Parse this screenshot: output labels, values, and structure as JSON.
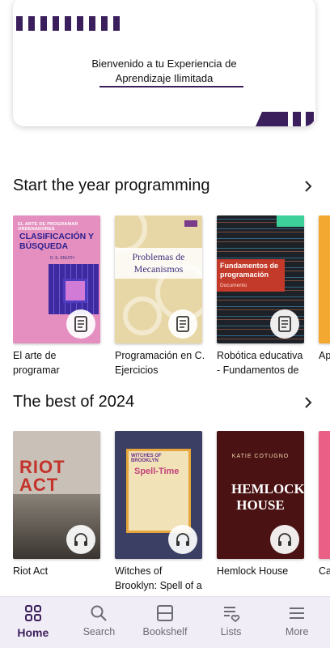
{
  "banner": {
    "line1": "Bienvenido a tu Experiencia de",
    "line2": "Aprendizaje Ilimitada"
  },
  "sections": [
    {
      "title": "Start the year programming",
      "books": [
        {
          "title": "El arte de programar",
          "cover_top": "EL ARTE DE PROGRAMAR ORDENADORES",
          "cover_title": "CLASIFICACIÓN Y BÚSQUEDA",
          "cover_author": "D. E. KNUTH",
          "badge": "document-icon"
        },
        {
          "title": "Programación en C. Ejercicios",
          "cover_title": "Problemas de Mecanismos",
          "badge": "document-icon"
        },
        {
          "title": "Robótica educativa - Fundamentos de",
          "cover_title": "Fundamentos de programación",
          "cover_sub": "Documento",
          "badge": "document-icon"
        },
        {
          "title": "Ap",
          "badge": "document-icon"
        }
      ]
    },
    {
      "title": "The best of 2024",
      "books": [
        {
          "title": "Riot Act",
          "cover_title": "RIOT ACT",
          "badge": "headphones-icon"
        },
        {
          "title": "Witches of Brooklyn: Spell of a",
          "cover_title_1": "WITCHES OF BROOKLYN",
          "cover_title_2": "Spell-Time",
          "badge": "headphones-icon"
        },
        {
          "title": "Hemlock House",
          "cover_author": "KATIE COTUGNO",
          "cover_title": "HEMLOCK HOUSE",
          "badge": "headphones-icon"
        },
        {
          "title": "Ca",
          "badge": "headphones-icon"
        }
      ]
    }
  ],
  "nav": {
    "items": [
      {
        "label": "Home",
        "icon": "home-grid-icon",
        "active": true
      },
      {
        "label": "Search",
        "icon": "search-icon",
        "active": false
      },
      {
        "label": "Bookshelf",
        "icon": "bookshelf-icon",
        "active": false
      },
      {
        "label": "Lists",
        "icon": "lists-icon",
        "active": false
      },
      {
        "label": "More",
        "icon": "menu-icon",
        "active": false
      }
    ]
  },
  "colors": {
    "accent": "#3b1f5c",
    "nav_bg": "#f1edf6"
  }
}
